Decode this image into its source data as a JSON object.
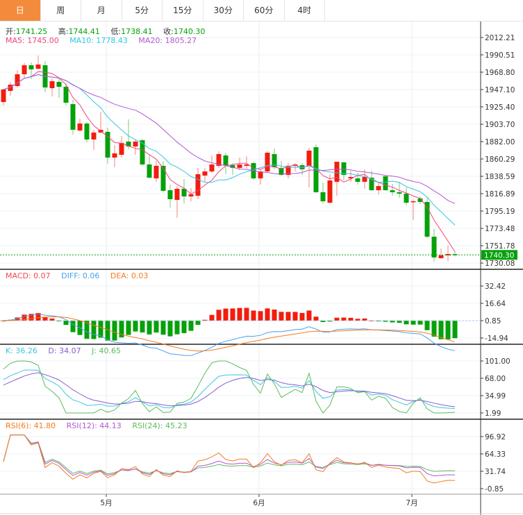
{
  "tabs": [
    "日",
    "周",
    "月",
    "5分",
    "15分",
    "30分",
    "60分",
    "4时"
  ],
  "active_tab": 0,
  "ohlc_legend": {
    "open_label": "开:",
    "open": "1741.25",
    "high_label": "高:",
    "high": "1744.41",
    "low_label": "低:",
    "low": "1738.41",
    "close_label": "收:",
    "close": "1740.30"
  },
  "ma_legend": {
    "ma5": "MA5: 1745.00",
    "ma10": "MA10: 1778.43",
    "ma20": "MA20: 1805.27"
  },
  "macd_legend": {
    "macd": "MACD: 0.07",
    "diff": "DIFF: 0.06",
    "dea": "DEA: 0.03"
  },
  "kdj_legend": {
    "k": "K: 36.26",
    "d": "D: 34.07",
    "j": "J: 40.65"
  },
  "rsi_legend": {
    "rsi6": "RSI(6): 41.80",
    "rsi12": "RSI(12): 44.13",
    "rsi24": "RSI(24): 45.23"
  },
  "price_axis": [
    "2012.21",
    "1990.51",
    "1968.80",
    "1947.10",
    "1925.40",
    "1903.70",
    "1882.00",
    "1860.29",
    "1838.59",
    "1816.89",
    "1795.19",
    "1773.48",
    "1751.78",
    "1730.08"
  ],
  "last_price": "1740.30",
  "macd_axis": [
    "32.42",
    "16.64",
    "0.85",
    "-14.94"
  ],
  "kdj_axis": [
    "101.00",
    "68.00",
    "34.99",
    "1.99"
  ],
  "rsi_axis": [
    "96.92",
    "64.33",
    "31.74",
    "-0.85"
  ],
  "x_labels": [
    {
      "label": "5月",
      "index": 14.8
    },
    {
      "label": "6月",
      "index": 36.8
    },
    {
      "label": "7月",
      "index": 58.8
    }
  ],
  "colors": {
    "up": "#f21d0e",
    "down": "#04a10a",
    "ma5": "#f0457c",
    "ma10": "#34c5de",
    "ma20": "#b456d2",
    "diff": "#4a9ef0",
    "dea": "#f57a1e",
    "k": "#3cc6e0",
    "d": "#8a5ad0",
    "j": "#5cba5c",
    "rsi6": "#f57a1e",
    "rsi12": "#b456d2",
    "rsi24": "#5cba5c",
    "tab_active": "#f28c3c"
  },
  "chart_data": {
    "type": "candlestick",
    "ohlc": [
      [
        1931.5,
        1948.0,
        1927.1,
        1947.1
      ],
      [
        1945.4,
        1956.7,
        1939.3,
        1953.2
      ],
      [
        1951.5,
        1971.4,
        1949.7,
        1966.2
      ],
      [
        1966.2,
        1980.1,
        1961.9,
        1977.5
      ],
      [
        1977.5,
        1981.0,
        1960.1,
        1972.3
      ],
      [
        1973.1,
        1989.6,
        1972.3,
        1978.4
      ],
      [
        1977.5,
        1982.7,
        1943.6,
        1949.7
      ],
      [
        1948.8,
        1961.0,
        1938.4,
        1957.5
      ],
      [
        1956.7,
        1961.0,
        1936.7,
        1950.6
      ],
      [
        1950.6,
        1954.9,
        1927.1,
        1930.6
      ],
      [
        1928.9,
        1934.1,
        1890.7,
        1896.8
      ],
      [
        1895.9,
        1910.7,
        1894.2,
        1904.6
      ],
      [
        1904.6,
        1906.3,
        1881.1,
        1884.6
      ],
      [
        1884.6,
        1896.8,
        1871.6,
        1893.3
      ],
      [
        1893.3,
        1919.3,
        1892.4,
        1896.8
      ],
      [
        1894.2,
        1899.4,
        1854.2,
        1862.0
      ],
      [
        1862.0,
        1877.7,
        1849.9,
        1867.3
      ],
      [
        1865.5,
        1889.0,
        1862.0,
        1880.3
      ],
      [
        1882.0,
        1909.8,
        1872.5,
        1875.9
      ],
      [
        1875.9,
        1883.7,
        1865.5,
        1882.0
      ],
      [
        1883.7,
        1885.5,
        1851.7,
        1853.4
      ],
      [
        1853.4,
        1865.5,
        1836.0,
        1836.9
      ],
      [
        1836.0,
        1857.7,
        1831.7,
        1851.7
      ],
      [
        1851.7,
        1857.7,
        1818.7,
        1820.4
      ],
      [
        1821.2,
        1828.2,
        1799.5,
        1810.0
      ],
      [
        1809.1,
        1826.4,
        1786.6,
        1823.0
      ],
      [
        1823.0,
        1835.1,
        1804.8,
        1813.4
      ],
      [
        1813.4,
        1823.8,
        1807.4,
        1816.1
      ],
      [
        1814.3,
        1849.1,
        1810.0,
        1841.2
      ],
      [
        1839.5,
        1849.1,
        1831.7,
        1844.7
      ],
      [
        1844.7,
        1864.7,
        1842.9,
        1853.4
      ],
      [
        1851.7,
        1869.9,
        1849.1,
        1866.4
      ],
      [
        1864.7,
        1868.1,
        1841.2,
        1852.5
      ],
      [
        1852.5,
        1855.1,
        1840.3,
        1849.1
      ],
      [
        1849.1,
        1862.0,
        1846.4,
        1853.4
      ],
      [
        1851.7,
        1863.8,
        1848.2,
        1853.4
      ],
      [
        1855.1,
        1856.8,
        1834.3,
        1836.0
      ],
      [
        1836.0,
        1848.2,
        1828.2,
        1844.7
      ],
      [
        1844.7,
        1869.9,
        1842.9,
        1868.1
      ],
      [
        1866.4,
        1873.3,
        1847.3,
        1849.9
      ],
      [
        1849.1,
        1857.7,
        1839.5,
        1840.3
      ],
      [
        1840.3,
        1855.1,
        1836.0,
        1851.7
      ],
      [
        1851.7,
        1855.1,
        1844.7,
        1853.4
      ],
      [
        1852.5,
        1855.1,
        1840.3,
        1847.3
      ],
      [
        1851.7,
        1874.2,
        1824.7,
        1870.7
      ],
      [
        1875.0,
        1878.5,
        1817.8,
        1818.7
      ],
      [
        1818.7,
        1830.8,
        1804.8,
        1807.4
      ],
      [
        1805.5,
        1841.2,
        1804.8,
        1833.4
      ],
      [
        1831.7,
        1856.8,
        1814.3,
        1856.8
      ],
      [
        1856.0,
        1856.8,
        1833.4,
        1840.3
      ],
      [
        1836.0,
        1845.5,
        1831.7,
        1837.7
      ],
      [
        1836.0,
        1842.9,
        1828.2,
        1831.7
      ],
      [
        1831.7,
        1847.3,
        1823.0,
        1837.7
      ],
      [
        1836.9,
        1845.5,
        1820.4,
        1821.2
      ],
      [
        1821.2,
        1830.8,
        1816.1,
        1826.4
      ],
      [
        1838.6,
        1840.3,
        1820.4,
        1821.2
      ],
      [
        1821.2,
        1829.0,
        1814.3,
        1818.7
      ],
      [
        1818.7,
        1831.7,
        1811.7,
        1816.9
      ],
      [
        1816.9,
        1824.7,
        1802.2,
        1805.5
      ],
      [
        1806.5,
        1809.1,
        1783.9,
        1807.4
      ],
      [
        1810.8,
        1813.4,
        1803.9,
        1806.5
      ],
      [
        1806.5,
        1811.7,
        1761.4,
        1763.1
      ],
      [
        1763.1,
        1772.6,
        1731.7,
        1737.1
      ],
      [
        1736.2,
        1748.3,
        1735.3,
        1739.7
      ],
      [
        1739.7,
        1751.8,
        1732.6,
        1741.4
      ],
      [
        1741.25,
        1744.41,
        1738.41,
        1740.3
      ]
    ],
    "ylim": [
      1730.08,
      2012.21
    ]
  }
}
